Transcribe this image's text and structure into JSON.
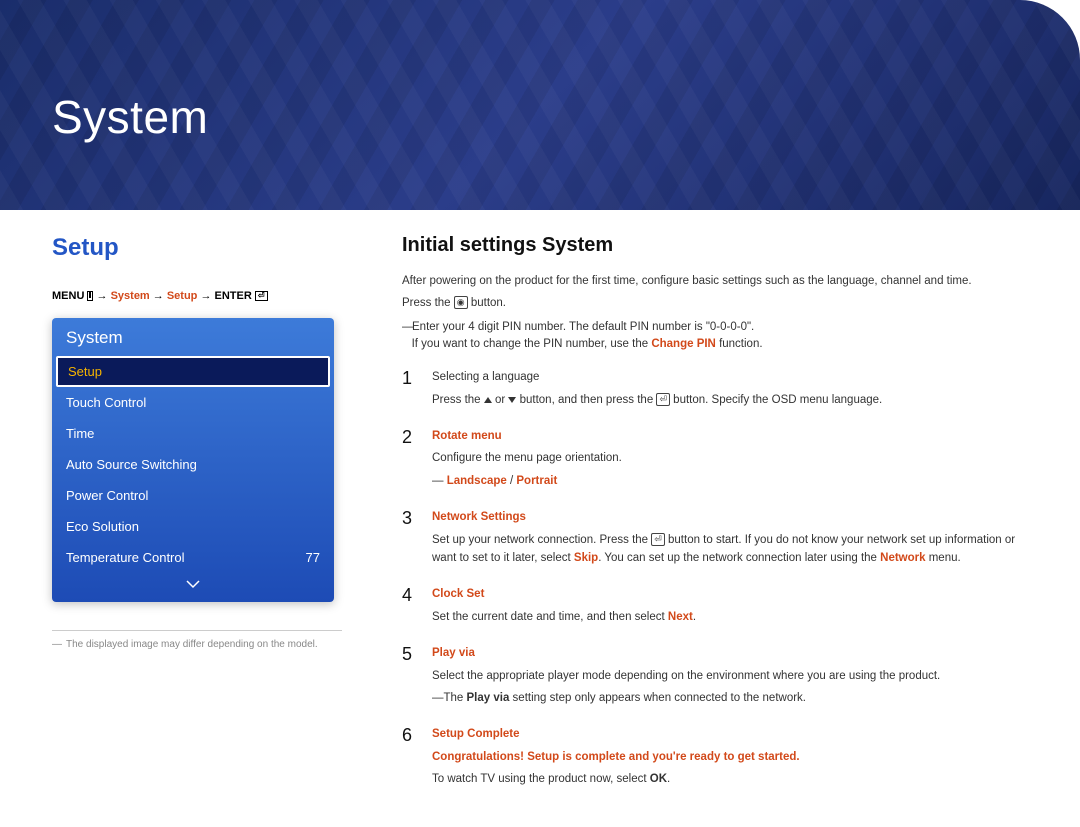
{
  "hero": {
    "title": "System"
  },
  "left": {
    "section_title": "Setup",
    "breadcrumb": {
      "menu": "MENU",
      "system": "System",
      "setup": "Setup",
      "enter": "ENTER",
      "arrow": "→"
    },
    "osd": {
      "header": "System",
      "items": [
        {
          "label": "Setup",
          "value": "",
          "selected": true
        },
        {
          "label": "Touch Control",
          "value": ""
        },
        {
          "label": "Time",
          "value": ""
        },
        {
          "label": "Auto Source Switching",
          "value": ""
        },
        {
          "label": "Power Control",
          "value": ""
        },
        {
          "label": "Eco Solution",
          "value": ""
        },
        {
          "label": "Temperature Control",
          "value": "77"
        }
      ]
    },
    "note": "The displayed image may differ depending on the model."
  },
  "right": {
    "heading": "Initial settings System",
    "intro1": "After powering on the product for the first time, configure basic settings such as the language, channel and time.",
    "intro2_pre": "Press the ",
    "intro2_post": " button.",
    "pin_line": "Enter your 4 digit PIN number. The default PIN number is \"0-0-0-0\".",
    "pin_change_pre": "If you want to change the PIN number, use the ",
    "pin_change_bold": "Change PIN",
    "pin_change_post": " function.",
    "steps": {
      "1": {
        "title": "Selecting a language",
        "body_pre": "Press the ",
        "body_mid": " or ",
        "body_mid2": " button, and then press the ",
        "body_post": " button. Specify the OSD menu language."
      },
      "2": {
        "title": "Rotate menu",
        "line1": "Configure the menu page orientation.",
        "opts_a": "Landscape",
        "opts_sep": " / ",
        "opts_b": "Portrait"
      },
      "3": {
        "title": "Network Settings",
        "line_pre": "Set up your network connection. Press the ",
        "line_mid": " button to start. If you do not know your network set up information or want to set to it later, select ",
        "skip": "Skip",
        "line_mid2": ". You can set up the network connection later using the ",
        "network": "Network",
        "line_post": " menu."
      },
      "4": {
        "title": "Clock Set",
        "line_pre": "Set the current date and time, and then select ",
        "next": "Next",
        "line_post": "."
      },
      "5": {
        "title": "Play via",
        "line1": "Select the appropriate player mode depending on the environment where you are using the product.",
        "note_pre": "The ",
        "note_bold": "Play via",
        "note_post": " setting step only appears when connected to the network."
      },
      "6": {
        "title": "Setup Complete",
        "congrats": "Congratulations! Setup is complete and you're ready to get started.",
        "line_pre": "To watch TV using the product now, select ",
        "ok": "OK",
        "line_post": "."
      }
    }
  }
}
